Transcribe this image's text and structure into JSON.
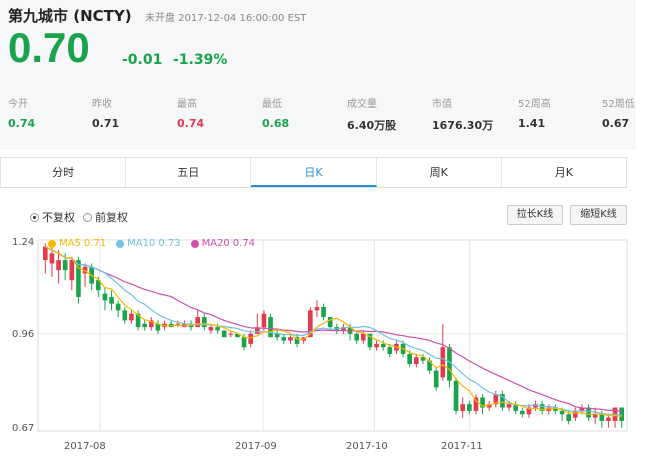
{
  "header": {
    "title": "第九城市 (NCTY)",
    "status": "未开盘 2017-12-04 16:00:00 EST",
    "price": "0.70",
    "change": "-0.01",
    "change_pct": "-1.39%"
  },
  "stats": [
    {
      "label": "今开",
      "value": "0.74"
    },
    {
      "label": "昨收",
      "value": "0.71"
    },
    {
      "label": "最高",
      "value": "0.74"
    },
    {
      "label": "最低",
      "value": "0.68"
    },
    {
      "label": "成交量",
      "value": "6.40万股"
    },
    {
      "label": "市值",
      "value": "1676.30万"
    },
    {
      "label": "52周高",
      "value": "1.41"
    },
    {
      "label": "52周低",
      "value": "0.67"
    }
  ],
  "tabs": [
    "分时",
    "五日",
    "日K",
    "周K",
    "月K"
  ],
  "controls": {
    "radio_1": "不复权",
    "radio_2": "前复权",
    "stretch_button": "拉长K线",
    "shrink_button": "缩短K线"
  },
  "colors": {
    "up": "#e23a4e",
    "down": "#1aa34a",
    "ma5": "#f5b800",
    "ma10": "#6ec3e3",
    "ma20": "#d04fa8"
  },
  "chart_data": {
    "type": "candlestick",
    "legend": [
      {
        "name": "MA5",
        "value": "0.71"
      },
      {
        "name": "MA10",
        "value": "0.73"
      },
      {
        "name": "MA20",
        "value": "0.74"
      }
    ],
    "y_ticks": [
      "1.24",
      "0.96",
      "0.67"
    ],
    "x_ticks": [
      "2017-08",
      "2017-09",
      "2017-10",
      "2017-11"
    ],
    "ylim": [
      0.67,
      1.24
    ],
    "candles": [
      [
        1.18,
        1.22,
        1.23,
        1.14
      ],
      [
        1.17,
        1.2,
        1.24,
        1.13
      ],
      [
        1.15,
        1.18,
        1.21,
        1.11
      ],
      [
        1.18,
        1.15,
        1.2,
        1.12
      ],
      [
        1.12,
        1.18,
        1.19,
        1.09
      ],
      [
        1.18,
        1.07,
        1.19,
        1.05
      ],
      [
        1.14,
        1.16,
        1.17,
        1.1
      ],
      [
        1.16,
        1.11,
        1.17,
        1.09
      ],
      [
        1.12,
        1.09,
        1.13,
        1.07
      ],
      [
        1.08,
        1.06,
        1.1,
        1.03
      ],
      [
        1.07,
        1.05,
        1.09,
        1.03
      ],
      [
        1.05,
        1.03,
        1.06,
        1.01
      ],
      [
        1.03,
        1.0,
        1.04,
        0.99
      ],
      [
        1.0,
        1.02,
        1.03,
        0.99
      ],
      [
        1.02,
        0.98,
        1.03,
        0.97
      ],
      [
        0.99,
        0.98,
        1.0,
        0.97
      ],
      [
        0.98,
        1.0,
        1.01,
        0.97
      ],
      [
        0.99,
        0.97,
        1.0,
        0.96
      ],
      [
        0.98,
        0.99,
        1.0,
        0.97
      ],
      [
        0.99,
        0.98,
        1.0,
        0.98
      ],
      [
        0.99,
        0.99,
        1.0,
        0.98
      ],
      [
        0.98,
        0.99,
        1.0,
        0.98
      ],
      [
        0.99,
        0.98,
        1.0,
        0.97
      ],
      [
        0.98,
        1.01,
        1.03,
        0.98
      ],
      [
        1.01,
        0.98,
        1.02,
        0.97
      ],
      [
        0.97,
        0.98,
        0.99,
        0.96
      ],
      [
        0.98,
        0.97,
        0.99,
        0.96
      ],
      [
        0.97,
        0.95,
        0.97,
        0.95
      ],
      [
        0.96,
        0.96,
        0.97,
        0.95
      ],
      [
        0.96,
        0.95,
        0.96,
        0.95
      ],
      [
        0.95,
        0.92,
        0.96,
        0.91
      ],
      [
        0.93,
        0.96,
        0.97,
        0.92
      ],
      [
        0.96,
        0.98,
        1.02,
        0.96
      ],
      [
        0.98,
        1.02,
        1.03,
        0.97
      ],
      [
        1.01,
        0.95,
        1.02,
        0.95
      ],
      [
        0.96,
        0.95,
        0.97,
        0.94
      ],
      [
        0.95,
        0.94,
        0.96,
        0.93
      ],
      [
        0.94,
        0.95,
        0.96,
        0.93
      ],
      [
        0.95,
        0.93,
        0.96,
        0.92
      ],
      [
        0.94,
        0.95,
        0.95,
        0.93
      ],
      [
        0.95,
        1.03,
        1.04,
        0.95
      ],
      [
        1.03,
        1.04,
        1.06,
        1.01
      ],
      [
        1.04,
        1.01,
        1.05,
        1.0
      ],
      [
        1.01,
        0.98,
        1.01,
        0.97
      ],
      [
        0.98,
        0.97,
        0.99,
        0.96
      ],
      [
        0.97,
        0.98,
        0.99,
        0.96
      ],
      [
        0.98,
        0.96,
        0.99,
        0.94
      ],
      [
        0.96,
        0.94,
        0.97,
        0.93
      ],
      [
        0.94,
        0.96,
        0.97,
        0.93
      ],
      [
        0.96,
        0.92,
        0.96,
        0.91
      ],
      [
        0.92,
        0.93,
        0.94,
        0.91
      ],
      [
        0.93,
        0.92,
        0.94,
        0.91
      ],
      [
        0.92,
        0.9,
        0.93,
        0.89
      ],
      [
        0.91,
        0.93,
        0.94,
        0.9
      ],
      [
        0.93,
        0.9,
        0.94,
        0.89
      ],
      [
        0.9,
        0.87,
        0.91,
        0.86
      ],
      [
        0.87,
        0.89,
        0.9,
        0.86
      ],
      [
        0.89,
        0.88,
        0.9,
        0.87
      ],
      [
        0.88,
        0.85,
        0.89,
        0.84
      ],
      [
        0.85,
        0.8,
        0.86,
        0.79
      ],
      [
        0.83,
        0.92,
        0.99,
        0.82
      ],
      [
        0.92,
        0.82,
        0.93,
        0.8
      ],
      [
        0.82,
        0.73,
        0.83,
        0.72
      ],
      [
        0.73,
        0.75,
        0.77,
        0.71
      ],
      [
        0.75,
        0.73,
        0.76,
        0.72
      ],
      [
        0.73,
        0.77,
        0.78,
        0.72
      ],
      [
        0.77,
        0.74,
        0.78,
        0.72
      ],
      [
        0.74,
        0.75,
        0.76,
        0.73
      ],
      [
        0.75,
        0.78,
        0.79,
        0.74
      ],
      [
        0.78,
        0.74,
        0.79,
        0.73
      ],
      [
        0.74,
        0.75,
        0.76,
        0.73
      ],
      [
        0.75,
        0.73,
        0.76,
        0.72
      ],
      [
        0.73,
        0.72,
        0.74,
        0.71
      ],
      [
        0.72,
        0.74,
        0.75,
        0.71
      ],
      [
        0.74,
        0.75,
        0.76,
        0.73
      ],
      [
        0.75,
        0.73,
        0.76,
        0.72
      ],
      [
        0.73,
        0.74,
        0.75,
        0.72
      ],
      [
        0.74,
        0.73,
        0.75,
        0.72
      ],
      [
        0.73,
        0.72,
        0.74,
        0.7
      ],
      [
        0.72,
        0.7,
        0.73,
        0.69
      ],
      [
        0.71,
        0.73,
        0.74,
        0.7
      ],
      [
        0.73,
        0.74,
        0.75,
        0.72
      ],
      [
        0.74,
        0.71,
        0.75,
        0.7
      ],
      [
        0.71,
        0.72,
        0.74,
        0.69
      ],
      [
        0.72,
        0.7,
        0.73,
        0.68
      ],
      [
        0.7,
        0.71,
        0.72,
        0.68
      ],
      [
        0.7,
        0.74,
        0.74,
        0.68
      ],
      [
        0.74,
        0.7,
        0.74,
        0.68
      ]
    ]
  }
}
